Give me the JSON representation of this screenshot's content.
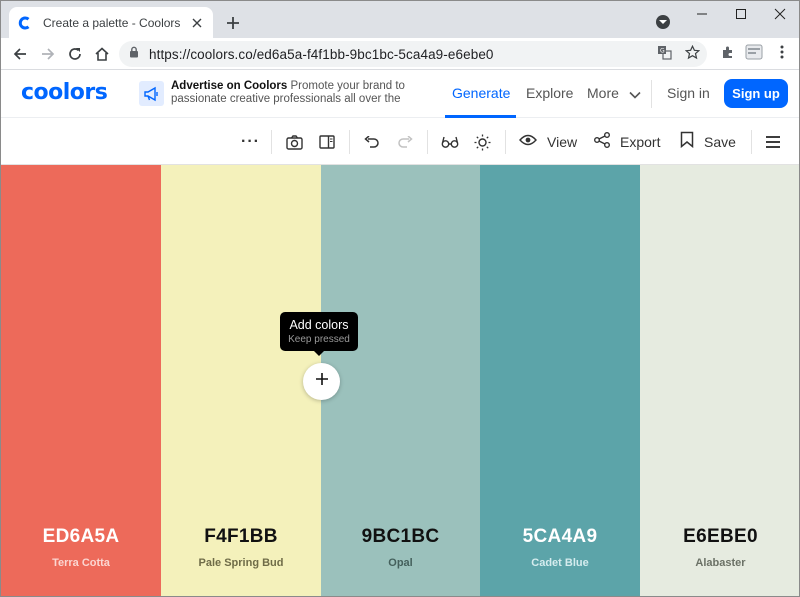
{
  "browser": {
    "tab_title": "Create a palette - Coolors",
    "url": "https://coolors.co/ed6a5a-f4f1bb-9bc1bc-5ca4a9-e6ebe0"
  },
  "site": {
    "logo": "coolors",
    "ad_title": "Advertise on Coolors",
    "ad_body": "Promote your brand to passionate creative professionals all over the",
    "nav": {
      "generate": "Generate",
      "explore": "Explore",
      "more": "More",
      "sign_in": "Sign in",
      "sign_up": "Sign up"
    }
  },
  "tools": {
    "more_dots": "···",
    "view": "View",
    "export": "Export",
    "save": "Save"
  },
  "tooltip": {
    "title": "Add colors",
    "subtitle": "Keep pressed"
  },
  "palette": [
    {
      "hex": "ED6A5A",
      "name": "Terra Cotta",
      "bg": "#ED6A5A",
      "hex_color": "#ffffff",
      "name_color": "#fbd6d1"
    },
    {
      "hex": "F4F1BB",
      "name": "Pale Spring Bud",
      "bg": "#F4F1BB",
      "hex_color": "#111111",
      "name_color": "#6f6c48"
    },
    {
      "hex": "9BC1BC",
      "name": "Opal",
      "bg": "#9BC1BC",
      "hex_color": "#111111",
      "name_color": "#44605c"
    },
    {
      "hex": "5CA4A9",
      "name": "Cadet Blue",
      "bg": "#5CA4A9",
      "hex_color": "#ffffff",
      "name_color": "#d5ecee"
    },
    {
      "hex": "E6EBE0",
      "name": "Alabaster",
      "bg": "#E6EBE0",
      "hex_color": "#111111",
      "name_color": "#6b7166"
    }
  ],
  "colors": {
    "accent": "#0066ff"
  }
}
